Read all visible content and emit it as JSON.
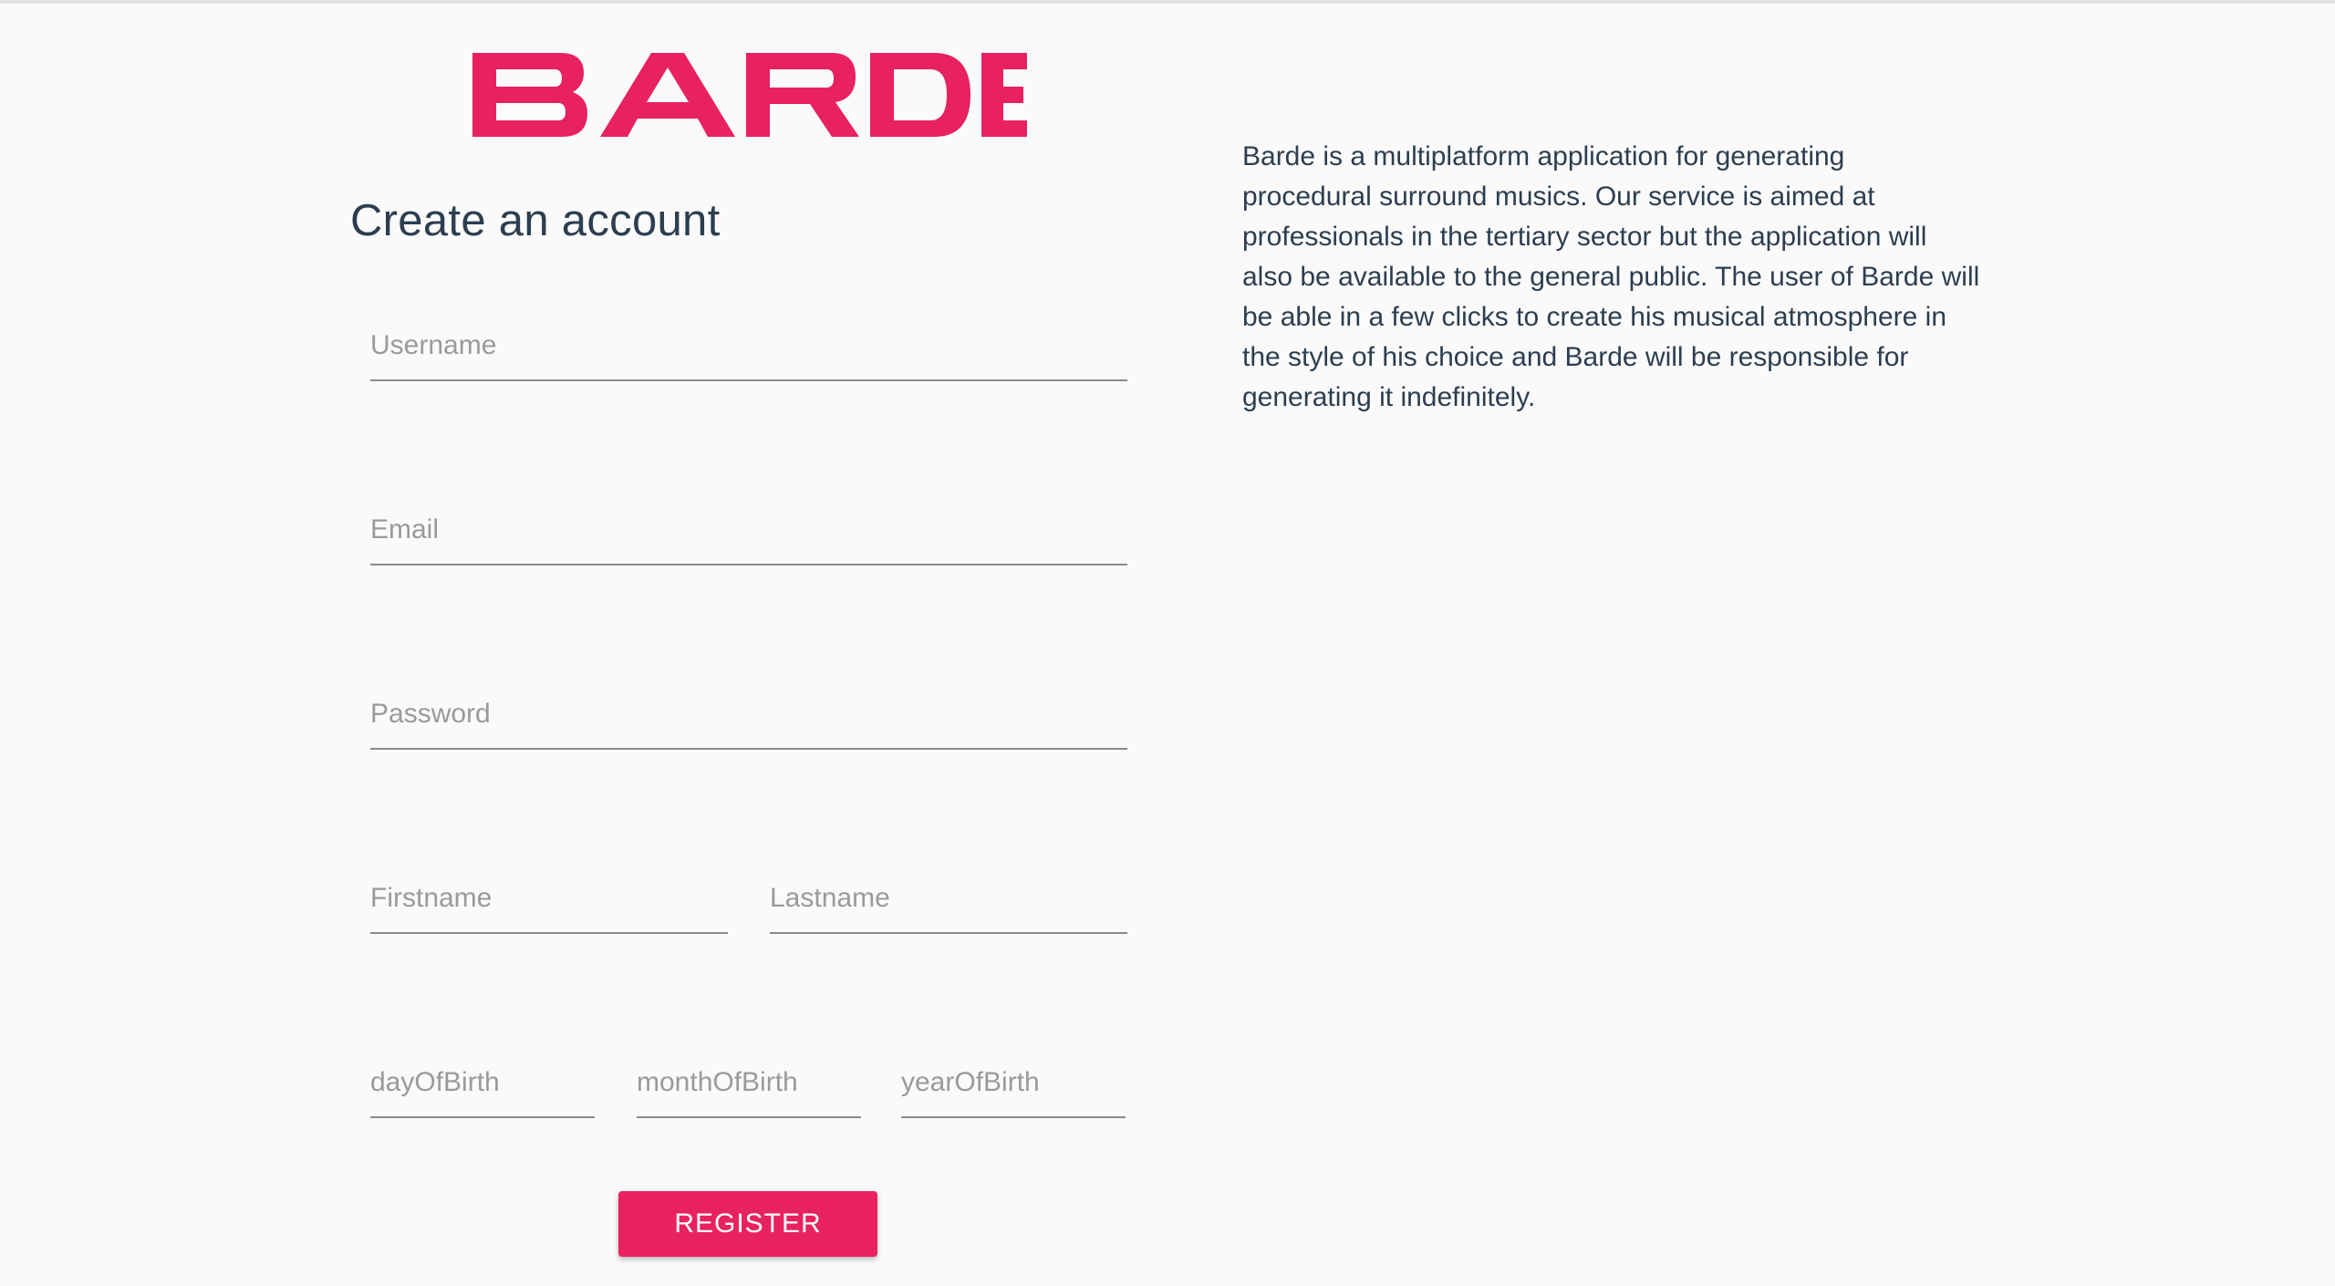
{
  "brand": {
    "logo_text": "BARDE",
    "accent_color": "#e8215f"
  },
  "form": {
    "title": "Create an account",
    "username_placeholder": "Username",
    "email_placeholder": "Email",
    "password_placeholder": "Password",
    "firstname_placeholder": "Firstname",
    "lastname_placeholder": "Lastname",
    "day_placeholder": "dayOfBirth",
    "month_placeholder": "monthOfBirth",
    "year_placeholder": "yearOfBirth",
    "register_label": "REGISTER"
  },
  "about": {
    "text": "Barde is a multiplatform application for generating procedural surround musics. Our service is aimed at professionals in the tertiary sector but the application will also be available to the general public. The user of Barde will be able in a few clicks to create his musical atmosphere in the style of his choice and Barde will be responsible for generating it indefinitely."
  }
}
